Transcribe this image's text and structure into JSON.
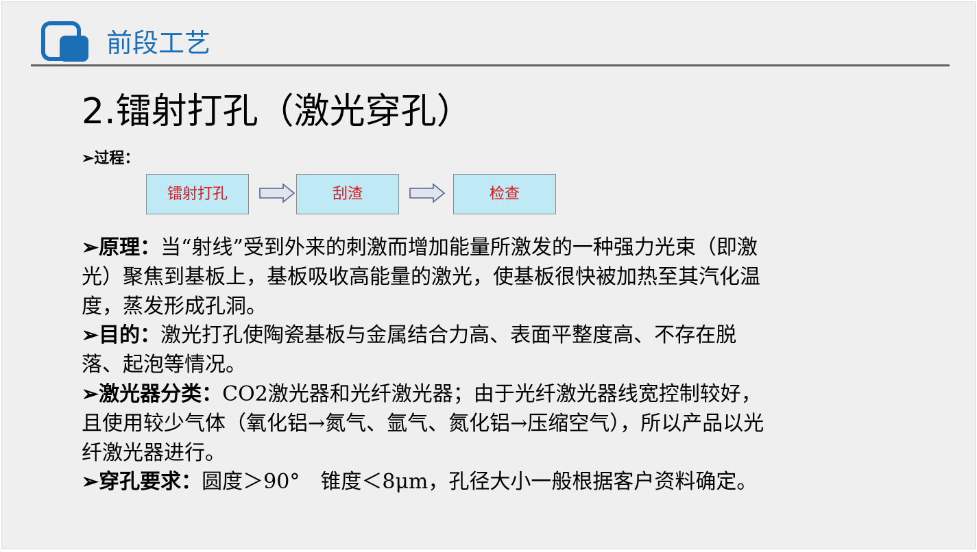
{
  "header": {
    "title": "前段工艺"
  },
  "title": "2.镭射打孔（激光穿孔）",
  "process": {
    "label": "➢过程：",
    "steps": [
      "镭射打孔",
      "刮渣",
      "检查"
    ]
  },
  "sections": [
    {
      "label": "➢原理：",
      "text": "当“射线”受到外来的刺激而增加能量所激发的一种强力光束（即激光）聚焦到基板上，基板吸收高能量的激光，使基板很快被加热至其汽化温度，蒸发形成孔洞。"
    },
    {
      "label": "➢目的：",
      "text": "激光打孔使陶瓷基板与金属结合力高、表面平整度高、不存在脱落、起泡等情况。"
    },
    {
      "label": "➢激光器分类：",
      "text": "CO2激光器和光纤激光器；由于光纤激光器线宽控制较好，且使用较少气体（氧化铝→氮气、氩气、氮化铝→压缩空气），所以产品以光纤激光器进行。"
    },
    {
      "label": "➢穿孔要求：",
      "text": "圆度＞90°　锥度＜8μm，孔径大小一般根据客户资料确定。"
    }
  ],
  "colors": {
    "header_blue": "#1a6fb7",
    "flow_box_fill": "#bfe9f5",
    "flow_text": "#e0161e"
  }
}
